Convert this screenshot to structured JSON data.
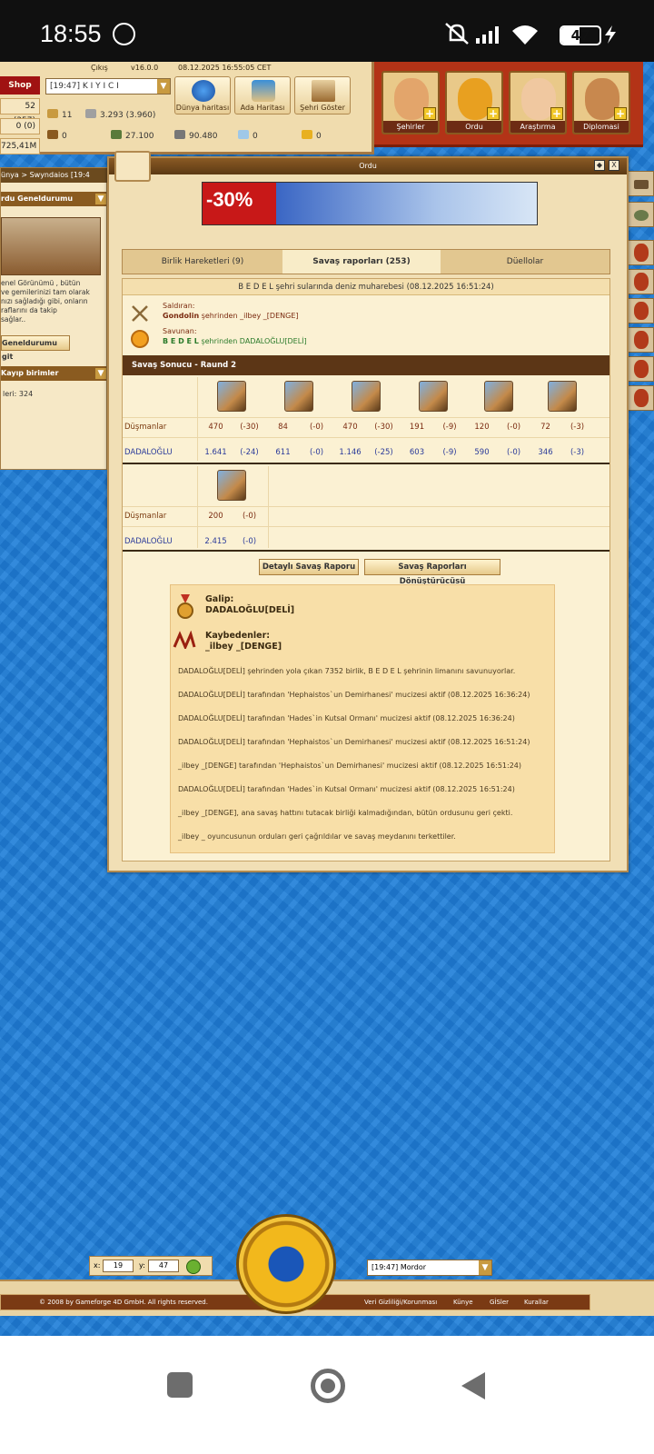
{
  "status": {
    "time": "18:55",
    "battery": "47"
  },
  "topbar": {
    "exit": "Çıkış",
    "version": "v16.0.0",
    "datetime": "08.12.2025 16:55:05 CET",
    "shop": "Shop",
    "city": "[19:47] K I Y I C I",
    "stats": [
      "52 (357)",
      "0 (0)",
      "725,41M"
    ],
    "nav": [
      "Dünya haritası",
      "Ada Haritası",
      "Şehri Göster"
    ],
    "res": [
      "11",
      "3.293 (3.960)",
      "0",
      "27.100",
      "90.480",
      "0",
      "0"
    ]
  },
  "advisors": [
    "Şehirler",
    "Ordu",
    "Araştırma",
    "Diplomasi"
  ],
  "left": {
    "breadcrumb": "ünya >",
    "breadcrumb2": "Swyndaios [19:4",
    "hdr1": "rdu Geneldurumu",
    "text": [
      "enel Görünümü , bütün",
      "ve gemilerinizi tam olarak",
      "nızı sağladığı gibi, onların",
      "raflarını da takip",
      "sağlar.."
    ],
    "goto": "Geneldurumu git",
    "hdr2": "Kayıp birimler",
    "lost": "leri: 324"
  },
  "window": {
    "title": "Ordu",
    "discount": "-30%",
    "tabs": [
      "Birlik Hareketleri (9)",
      "Savaş raporları (253)",
      "Düellolar"
    ],
    "heading": "B E D E L şehri sularında deniz muharebesi (08.12.2025 16:51:24)",
    "attacker_label": "Saldıran:",
    "attacker_name": "Gondolin",
    "attacker_rest": "şehrinden _ilbey _[DENGE]",
    "defender_label": "Savunan:",
    "defender_name": "B E D E L",
    "defender_rest": "şehrinden DADALOĞLU[DELİ]",
    "round": "Savaş Sonucu - Raund 2",
    "enemy_label": "Düşmanlar",
    "self_label": "DADALOĞLU",
    "enemy_row1": [
      [
        "470",
        "(-30)"
      ],
      [
        "84",
        "(-0)"
      ],
      [
        "470",
        "(-30)"
      ],
      [
        "191",
        "(-9)"
      ],
      [
        "120",
        "(-0)"
      ],
      [
        "72",
        "(-3)"
      ]
    ],
    "self_row1": [
      [
        "1.641",
        "(-24)"
      ],
      [
        "611",
        "(-0)"
      ],
      [
        "1.146",
        "(-25)"
      ],
      [
        "603",
        "(-9)"
      ],
      [
        "590",
        "(-0)"
      ],
      [
        "346",
        "(-3)"
      ]
    ],
    "enemy_row2": [
      [
        "200",
        "(-0)"
      ]
    ],
    "self_row2": [
      [
        "2.415",
        "(-0)"
      ]
    ],
    "btn_detail": "Detaylı Savaş Raporu",
    "btn_convert": "Savaş Raporları Dönüştürücüsü",
    "winner_label": "Galip:",
    "winner": "DADALOĞLU[DELİ]",
    "losers_label": "Kaybedenler:",
    "losers": "_ilbey _[DENGE]",
    "lines": [
      "DADALOĞLU[DELİ] şehrinden yola çıkan 7352 birlik, B E D E L şehrinin limanını savunuyorlar.",
      "DADALOĞLU[DELİ] tarafından 'Hephaistos`un Demirhanesi' mucizesi aktif (08.12.2025 16:36:24)",
      "DADALOĞLU[DELİ] tarafından 'Hades`in Kutsal Ormanı' mucizesi aktif (08.12.2025 16:36:24)",
      "DADALOĞLU[DELİ] tarafından 'Hephaistos`un Demirhanesi' mucizesi aktif (08.12.2025 16:51:24)",
      "_ilbey _[DENGE] tarafından 'Hephaistos`un Demirhanesi' mucizesi aktif (08.12.2025 16:51:24)",
      "DADALOĞLU[DELİ] tarafından 'Hades`in Kutsal Ormanı' mucizesi aktif (08.12.2025 16:51:24)",
      "_ilbey _[DENGE], ana savaş hattını tutacak birliği kalmadığından, bütün ordusunu geri çekti.",
      "_ilbey _ oyuncusunun orduları geri çağrıldılar ve savaş meydanını terkettiler."
    ]
  },
  "bottom": {
    "x_label": "x:",
    "x": "19",
    "y_label": "y:",
    "y": "47",
    "town": "[19:47] Mordor",
    "footer": [
      "© 2008 by Gameforge 4D GmbH. All rights reserved.",
      "Veri Gizliliği/Korunması",
      "Künye",
      "GİSler",
      "Kurallar"
    ]
  }
}
